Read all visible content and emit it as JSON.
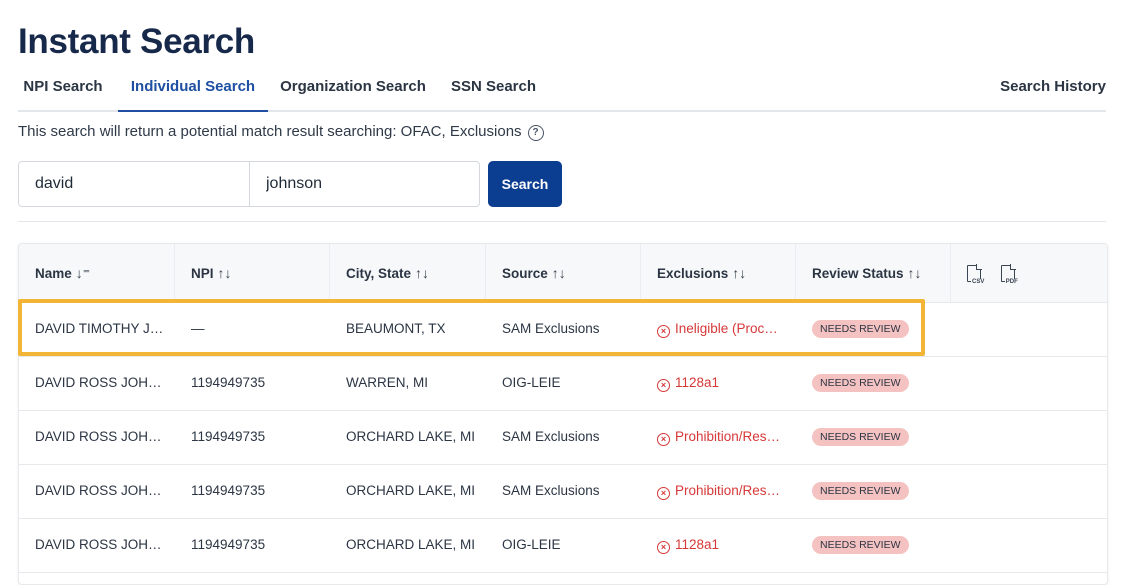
{
  "page": {
    "title": "Instant Search"
  },
  "tabs": {
    "npi": "NPI Search",
    "individual": "Individual Search",
    "organization": "Organization Search",
    "ssn": "SSN Search",
    "history": "Search History",
    "active": "individual"
  },
  "info": {
    "text": "This search will return a potential match result searching: OFAC, Exclusions",
    "help_icon": "?"
  },
  "search": {
    "first_value": "david",
    "last_value": "johnson",
    "button_label": "Search"
  },
  "table": {
    "headers": {
      "name": "Name",
      "npi": "NPI",
      "city": "City, State",
      "source": "Source",
      "exclusions": "Exclusions",
      "review": "Review Status",
      "csv": "CSV",
      "pdf": "PDF"
    },
    "sort_icons": {
      "name": "↓⁼",
      "other": "↑↓"
    },
    "rows": [
      {
        "name": "DAVID TIMOTHY J…",
        "npi": "—",
        "city": "BEAUMONT, TX",
        "source": "SAM Exclusions",
        "exclusion": "Ineligible (Proc…",
        "status": "NEEDS REVIEW"
      },
      {
        "name": "DAVID ROSS JOHN…",
        "npi": "1194949735",
        "city": "WARREN, MI",
        "source": "OIG-LEIE",
        "exclusion": "1128a1",
        "status": "NEEDS REVIEW"
      },
      {
        "name": "DAVID ROSS JOHN…",
        "npi": "1194949735",
        "city": "ORCHARD LAKE, MI",
        "source": "SAM Exclusions",
        "exclusion": "Prohibition/Res…",
        "status": "NEEDS REVIEW"
      },
      {
        "name": "DAVID ROSS JOHN…",
        "npi": "1194949735",
        "city": "ORCHARD LAKE, MI",
        "source": "SAM Exclusions",
        "exclusion": "Prohibition/Res…",
        "status": "NEEDS REVIEW"
      },
      {
        "name": "DAVID ROSS JOHN…",
        "npi": "1194949735",
        "city": "ORCHARD LAKE, MI",
        "source": "OIG-LEIE",
        "exclusion": "1128a1",
        "status": "NEEDS REVIEW"
      }
    ]
  },
  "colors": {
    "accent": "#0b3d91",
    "error": "#d63838",
    "badge": "#f5c2c2",
    "highlight": "#f2b535"
  }
}
